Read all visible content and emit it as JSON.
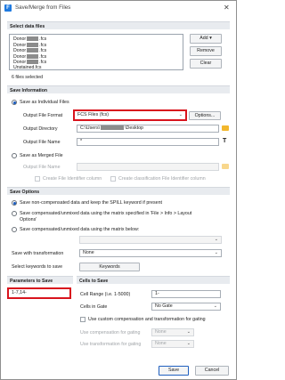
{
  "window": {
    "title": "Save/Merge from Files",
    "close_glyph": "✕",
    "app_icon": "F"
  },
  "data_files": {
    "header": "Select data files",
    "files": [
      {
        "prefix": "Donor",
        "suffix": ".fcs"
      },
      {
        "prefix": "Donor",
        "suffix": ".fcs"
      },
      {
        "prefix": "Donor",
        "suffix": ".fcs"
      },
      {
        "prefix": "Donor",
        "suffix": ".fcs"
      },
      {
        "prefix": "Donor",
        "suffix": ".fcs"
      },
      {
        "prefix": "Unstained.fcs",
        "suffix": ""
      }
    ],
    "add_label": "Add",
    "add_caret": "▾",
    "remove_label": "Remove",
    "clear_label": "Clear",
    "selected_count": "6 files selected"
  },
  "save_info": {
    "header": "Save Information",
    "individual_label": "Save as Individual Files",
    "format_label": "Output File Format",
    "format_value": "FCS Files (fcs)",
    "format_caret": "⌄",
    "options_label": "Options...",
    "directory_label": "Output Directory",
    "directory_prefix": "C:\\Users\\",
    "directory_suffix": "\\Desktop",
    "filename_label": "Output File Name",
    "filename_value": "*",
    "text_icon_glyph": "T",
    "merged_label": "Save as Merged File",
    "merged_filename_label": "Output File Name",
    "create_fid_label": "Create File Identifier column",
    "create_class_fid_label": "Create classification File Identifier column"
  },
  "save_options": {
    "header": "Save Options",
    "opt1": "Save non-compensated data and keep the SPILL keyword if present",
    "opt2_line1": "Save compensated/unmixed data using the matrix specified in 'File > Info > Layout",
    "opt2_line2": "Options'",
    "opt3": "Save compensated/unmixed data using the matrix below:",
    "transform_label": "Save with transformation",
    "transform_value": "None",
    "keywords_label": "Select keywords to save",
    "keywords_button": "Keywords"
  },
  "params": {
    "header": "Parameters to Save",
    "value": "1-7,14-"
  },
  "cells": {
    "header": "Cells to Save",
    "range_label": "Cell Range (i.e. 1-5000)",
    "range_value": "1-",
    "gate_label": "Cells in Gate",
    "gate_value": "No Gate",
    "custom_label": "Use custom compensation and transformation for gating",
    "comp_gating_label": "Use compensation for gating",
    "comp_gating_value": "None",
    "trans_gating_label": "Use transformation for gating",
    "trans_gating_value": "None"
  },
  "footer": {
    "save_label": "Save",
    "cancel_label": "Cancel"
  },
  "colors": {
    "highlight": "#d8141d",
    "accent": "#1f5fbf"
  }
}
